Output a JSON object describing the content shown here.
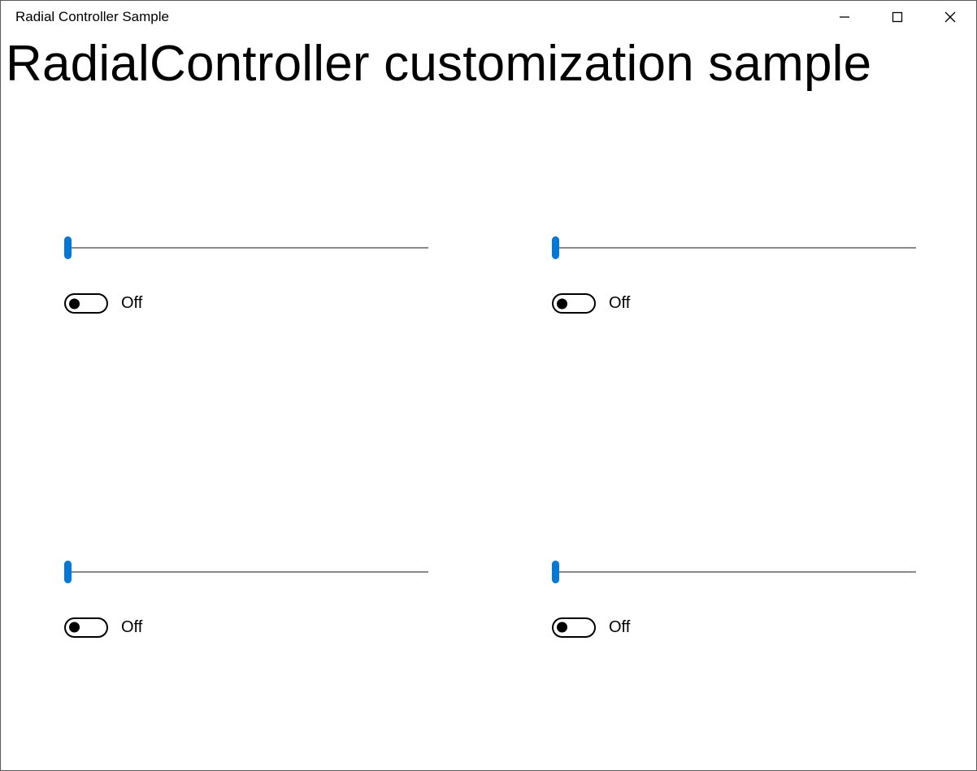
{
  "window": {
    "title": "Radial Controller Sample"
  },
  "page": {
    "heading": "RadialController customization sample"
  },
  "controls": {
    "items": [
      {
        "slider_value": 0,
        "toggle_state": "off",
        "toggle_label": "Off"
      },
      {
        "slider_value": 0,
        "toggle_state": "off",
        "toggle_label": "Off"
      },
      {
        "slider_value": 0,
        "toggle_state": "off",
        "toggle_label": "Off"
      },
      {
        "slider_value": 0,
        "toggle_state": "off",
        "toggle_label": "Off"
      }
    ]
  },
  "colors": {
    "accent": "#0078d7"
  }
}
